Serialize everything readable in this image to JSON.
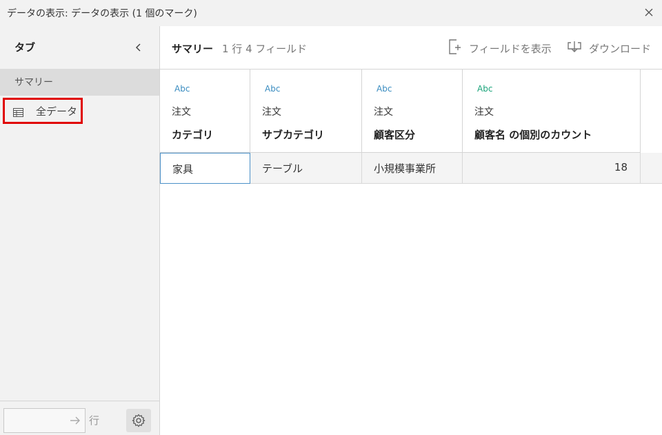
{
  "window": {
    "title": "データの表示: データの表示 (1 個のマーク)"
  },
  "sidebar": {
    "title": "タブ",
    "items": [
      {
        "label": "サマリー"
      },
      {
        "label": "全データ"
      }
    ],
    "row_suffix": "行"
  },
  "main": {
    "summary_title": "サマリー",
    "summary_info": "1 行 4 フィールド",
    "show_fields_label": "フィールドを表示",
    "download_label": "ダウンロード"
  },
  "table": {
    "columns": [
      {
        "type": "Abc",
        "source": "注文",
        "name": "カテゴリ"
      },
      {
        "type": "Abc",
        "source": "注文",
        "name": "サブカテゴリ"
      },
      {
        "type": "Abc",
        "source": "注文",
        "name": "顧客区分"
      },
      {
        "type": "Abc",
        "source": "注文",
        "name": "顧客名 の個別のカウント"
      }
    ],
    "rows": [
      [
        "家具",
        "テーブル",
        "小規模事業所",
        "18"
      ]
    ]
  },
  "colors": {
    "highlight_border": "#e00000",
    "dimension_type": "#3a8cc0",
    "measure_type": "#1aa37a"
  }
}
